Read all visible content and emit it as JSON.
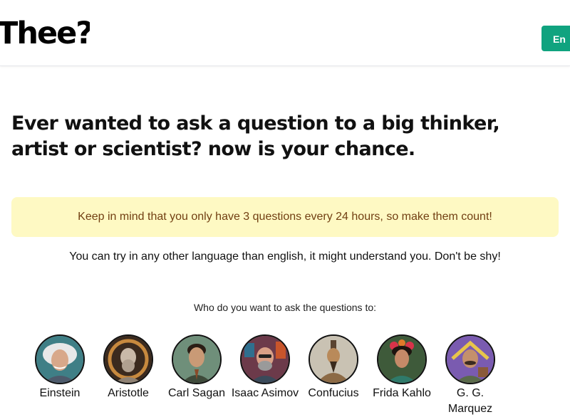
{
  "header": {
    "logo_text": "Thee?",
    "language_button": "En"
  },
  "headline": "Ever wanted to ask a question to a big thinker, artist or scientist? now is your chance.",
  "notice": "Keep in mind that you only have 3 questions every 24 hours, so make them count!",
  "language_note": "You can try in any other language than english, it might understand you. Don't be shy!",
  "thinkers_prompt": "Who do you want to ask the questions to:",
  "thinkers": [
    {
      "name": "Einstein",
      "icon": "einstein-portrait-icon"
    },
    {
      "name": "Aristotle",
      "icon": "aristotle-portrait-icon"
    },
    {
      "name": "Carl Sagan",
      "icon": "carl-sagan-portrait-icon"
    },
    {
      "name": "Isaac Asimov",
      "icon": "isaac-asimov-portrait-icon"
    },
    {
      "name": "Confucius",
      "icon": "confucius-portrait-icon"
    },
    {
      "name": "Frida Kahlo",
      "icon": "frida-kahlo-portrait-icon"
    },
    {
      "name": "G. G. Marquez",
      "icon": "gg-marquez-portrait-icon"
    }
  ],
  "colors": {
    "accent": "#10a37f",
    "notice_background": "#fef9c3",
    "notice_text": "#713f12"
  }
}
